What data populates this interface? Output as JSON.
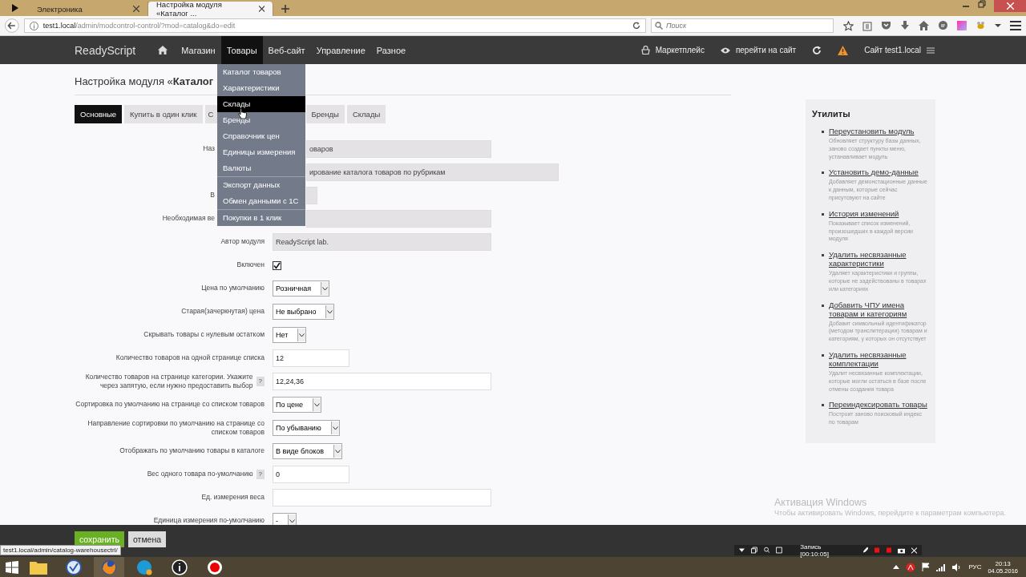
{
  "browser": {
    "tabs": [
      {
        "label": "Электроника",
        "selected": false
      },
      {
        "label": "Настройка модуля «Каталог ...",
        "selected": true
      }
    ],
    "address": {
      "host": "test1.local",
      "path": "/admin/modcontrol-control/?mod=catalog&do=edit"
    },
    "search": {
      "placeholder": "Поиск"
    }
  },
  "navbar": {
    "logo": "ReadyScript",
    "items": [
      {
        "label": "Магазин",
        "selected": false
      },
      {
        "label": "Товары",
        "selected": true
      },
      {
        "label": "Веб-сайт",
        "selected": false
      },
      {
        "label": "Управление",
        "selected": false
      },
      {
        "label": "Разное",
        "selected": false
      }
    ],
    "marketplace": "Маркетплейс",
    "visit_site": "перейти на сайт",
    "site": "Сайт test1.local"
  },
  "menu": {
    "groups": [
      [
        {
          "label": "Каталог товаров",
          "selected": false
        },
        {
          "label": "Характеристики",
          "selected": false
        },
        {
          "label": "Склады",
          "selected": true
        },
        {
          "label": "Бренды",
          "selected": false
        },
        {
          "label": "Справочник цен",
          "selected": false
        },
        {
          "label": "Единицы измерения",
          "selected": false
        },
        {
          "label": "Валюты",
          "selected": false
        }
      ],
      [
        {
          "label": "Экспорт данных",
          "selected": false
        },
        {
          "label": "Обмен данными с 1С",
          "selected": false
        }
      ],
      [
        {
          "label": "Покупки в 1 клик",
          "selected": false
        }
      ]
    ]
  },
  "page_title": "Настройка модуля «**Каталог**",
  "tabs": [
    {
      "label": "Основные",
      "selected": true
    },
    {
      "label": "Купить в один клик",
      "selected": false
    },
    {
      "label": "С",
      "selected": false
    },
    {
      "label": "Бренды",
      "selected": false
    },
    {
      "label": "Склады",
      "selected": false
    }
  ],
  "form": [
    {
      "kind": "partial",
      "label": "Наз",
      "value": "оваров",
      "disabled": true
    },
    {
      "kind": "partial",
      "value": "ирование каталога товаров по рубрикам",
      "disabled": true
    },
    {
      "kind": "partial",
      "label": "В",
      "disabled": true
    },
    {
      "kind": "partial",
      "label": "Необходимая ве",
      "disabled": true
    },
    {
      "kind": "text",
      "label": "Автор модуля",
      "value": "ReadyScript lab.",
      "disabled": true
    },
    {
      "kind": "checkbox",
      "label": "Включен",
      "checked": true
    },
    {
      "kind": "select",
      "label": "Цена по умолчанию",
      "value": "Розничная"
    },
    {
      "kind": "select",
      "label": "Старая(зачеркнутая) цена",
      "value": "Не выбрано"
    },
    {
      "kind": "select",
      "label": "Скрывать товары с нулевым остатком",
      "value": "Нет"
    },
    {
      "kind": "text",
      "label": "Количество товаров на одной странице списка",
      "value": "12",
      "disabled": false
    },
    {
      "kind": "text",
      "label": "Количество товаров на странице категории. Укажите через запятую, если нужно предоставить выбор",
      "help": "?",
      "value": "12,24,36",
      "disabled": false
    },
    {
      "kind": "select",
      "label": "Сортировка по умолчанию на странице со списком товаров",
      "value": "По цене"
    },
    {
      "kind": "select",
      "label": "Направление сортировки по умолчанию на странице со списком товаров",
      "value": "По убыванию"
    },
    {
      "kind": "select",
      "label": "Отображать по умолчанию товары в каталоге",
      "value": "В виде блоков"
    },
    {
      "kind": "text",
      "label": "Вес одного товара по-умолчанию",
      "help": "?",
      "value": "0",
      "disabled": false
    },
    {
      "kind": "text",
      "label": "Ед. измерения веса",
      "disabled": false
    },
    {
      "kind": "select",
      "label": "Единица измерения по-умолчанию",
      "value": "-"
    }
  ],
  "sidebar": {
    "title": "Утилиты",
    "items": [
      {
        "link": "Переустановить модуль",
        "description": "Обновляет структуру базы данных, заново создает пункты меню, устанавливает модуль"
      },
      {
        "link": "Установить демо-данные",
        "description": "Добавляет демонстационные данные к данным, которые сейчас присутсвуют на сайте"
      },
      {
        "link": "История изменений",
        "description": "Показывает список изменений, произошедших в каждой версии модуля"
      },
      {
        "link": "Удалить несвязанные характеристики",
        "description": "Удаляет характеристики и группы, которые не задействованы в товарах или категориях"
      },
      {
        "link": "Добавить ЧПУ имена товарам и категориям",
        "description": "Добавит символьный идентификатор (методом транслитерации) товарам и категориям, у которых он отсутствует"
      },
      {
        "link": "Удалить несвязанные комплектации",
        "description": "Удалит несвязанные комплектации, которые могли остаться в базе после отмены создания товара"
      },
      {
        "link": "Переиндексировать товары",
        "description": "Построит заново поисковый индекс по товарам"
      }
    ]
  },
  "actions": {
    "save": "сохранить",
    "cancel": "отмена"
  },
  "status_url": "test1.local/admin/catalog-warehousectrl/",
  "recorder": {
    "label": "Запись [00:10:05]"
  },
  "windows_notice": {
    "title": "Активация Windows",
    "text": "Чтобы активировать Windows, перейдите к параметрам компьютера."
  },
  "taskbar": {
    "language": "РУС",
    "time": "20:13",
    "date": "04.05.2016"
  }
}
